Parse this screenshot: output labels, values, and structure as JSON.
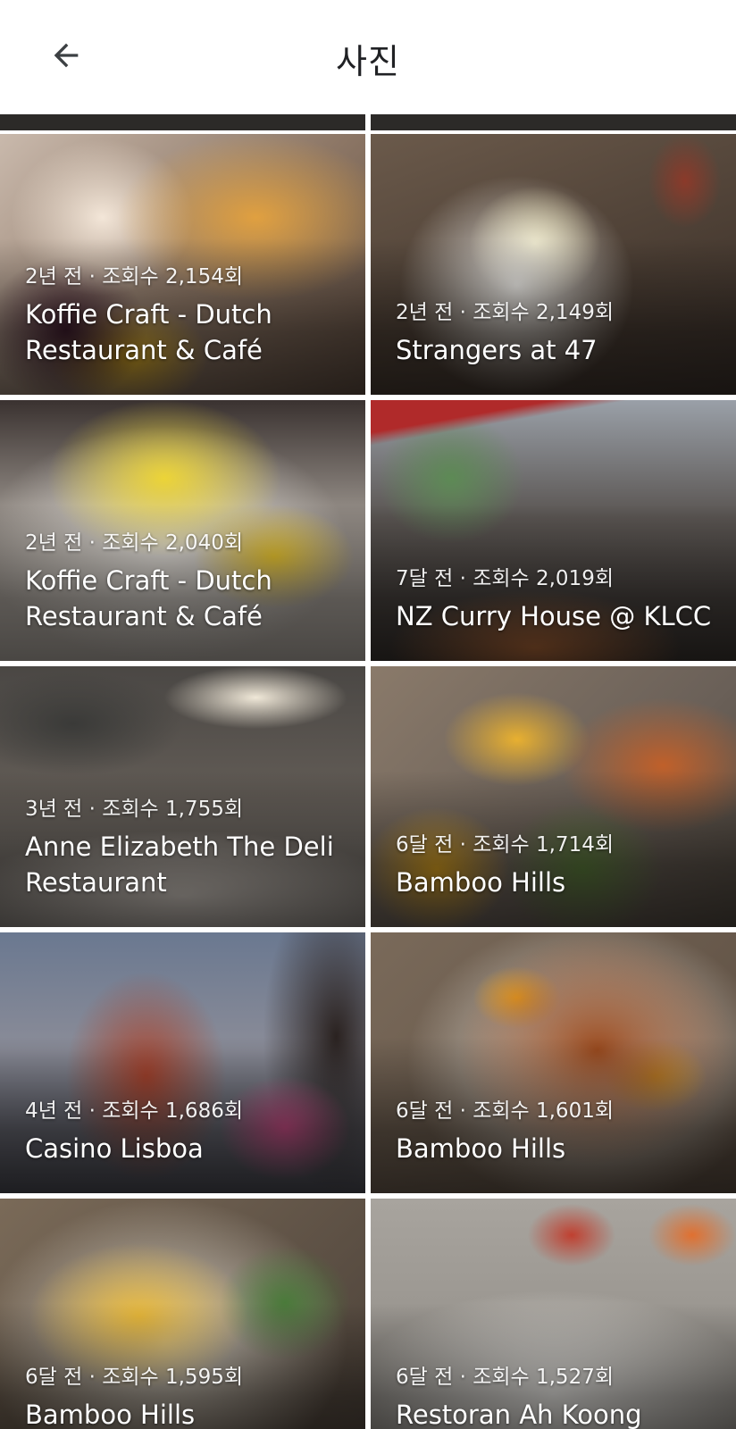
{
  "appbar": {
    "title": "사진",
    "back_icon": "arrow-left-icon"
  },
  "photos": [
    {
      "meta": "2년 전 · 조회수 2,154회",
      "name": "Koffie Craft - Dutch Restaurant & Café"
    },
    {
      "meta": "2년 전 · 조회수 2,149회",
      "name": "Strangers at 47"
    },
    {
      "meta": "2년 전 · 조회수 2,040회",
      "name": "Koffie Craft - Dutch Restaurant & Café"
    },
    {
      "meta": "7달 전 · 조회수 2,019회",
      "name": "NZ Curry House @ KLCC"
    },
    {
      "meta": "3년 전 · 조회수 1,755회",
      "name": "Anne Elizabeth The Deli Restaurant"
    },
    {
      "meta": "6달 전 · 조회수 1,714회",
      "name": "Bamboo Hills"
    },
    {
      "meta": "4년 전 · 조회수 1,686회",
      "name": "Casino Lisboa"
    },
    {
      "meta": "6달 전 · 조회수 1,601회",
      "name": "Bamboo Hills"
    },
    {
      "meta": "6달 전 · 조회수 1,595회",
      "name": "Bamboo Hills"
    },
    {
      "meta": "6달 전 · 조회수 1,527회",
      "name": "Restoran Ah Koong"
    }
  ]
}
